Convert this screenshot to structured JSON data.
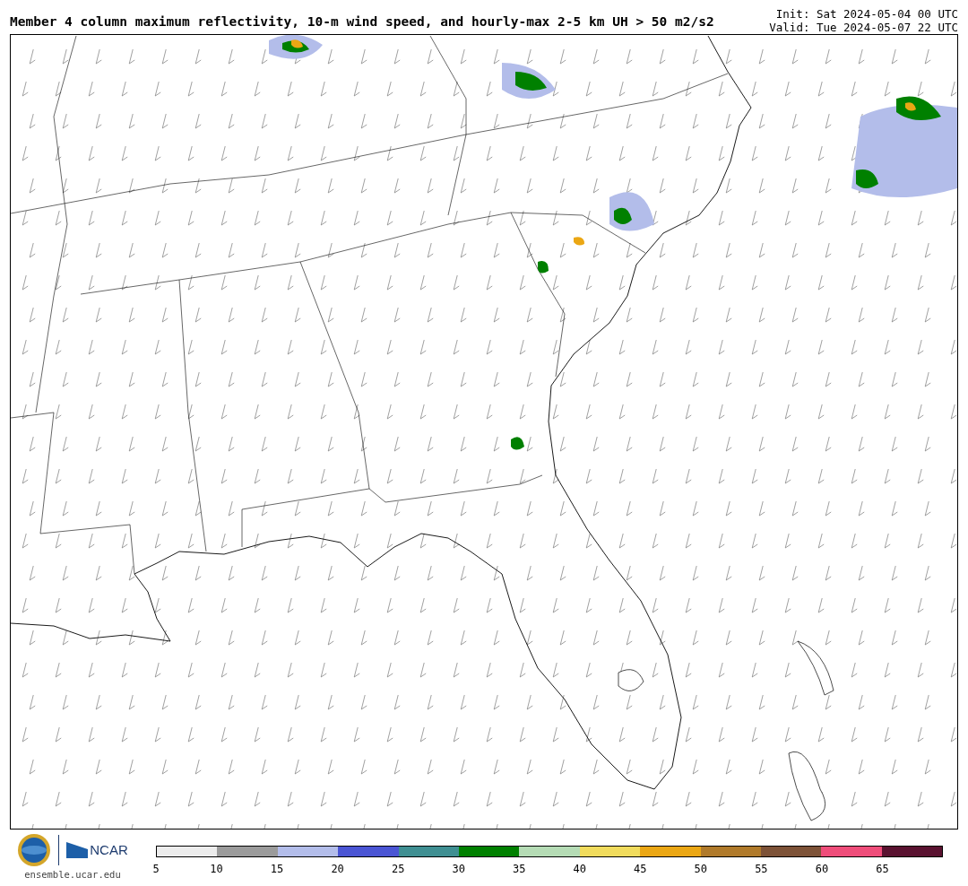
{
  "title": "Member 4 column maximum reflectivity, 10-m wind speed, and hourly-max 2-5 km UH > 50 m2/s2",
  "init": "Init: Sat 2024-05-04 00 UTC",
  "valid": "Valid: Tue 2024-05-07 22 UTC",
  "logos": {
    "ncar": "NCAR",
    "site": "ensemble.ucar.edu"
  },
  "colorbar": {
    "bins": [
      {
        "color": "#ececec"
      },
      {
        "color": "#9b9b9b"
      },
      {
        "color": "#b3bdea"
      },
      {
        "color": "#4a55d4"
      },
      {
        "color": "#3f8f92"
      },
      {
        "color": "#008000"
      },
      {
        "color": "#b5dcb5"
      },
      {
        "color": "#f1dc5d"
      },
      {
        "color": "#eba714"
      },
      {
        "color": "#b07a2a"
      },
      {
        "color": "#7d5237"
      },
      {
        "color": "#ef4d7a"
      },
      {
        "color": "#5a1230"
      }
    ],
    "ticks": [
      "5",
      "10",
      "15",
      "20",
      "25",
      "30",
      "35",
      "40",
      "45",
      "50",
      "55",
      "60",
      "65"
    ]
  }
}
